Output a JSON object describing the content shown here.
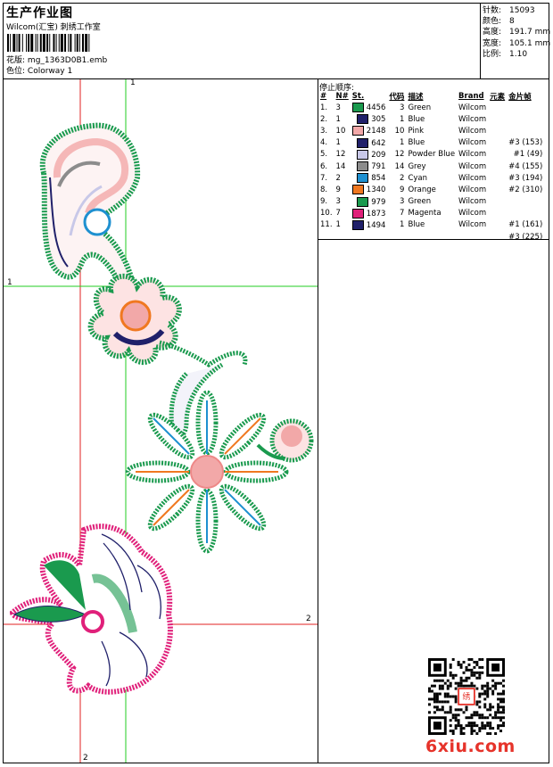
{
  "header": {
    "title": "生产作业图",
    "company": "Wilcom(汇宝) 刺绣工作室",
    "design_label": "花版:",
    "design_file": "mg_1363D0B1.emb",
    "colorway_label": "色位:",
    "colorway": "Colorway 1"
  },
  "stats": [
    {
      "label": "针数:",
      "value": "15093"
    },
    {
      "label": "颜色:",
      "value": "8"
    },
    {
      "label": "高度:",
      "value": "191.7 mm"
    },
    {
      "label": "宽度:",
      "value": "105.1 mm"
    },
    {
      "label": "比例:",
      "value": "1.10"
    }
  ],
  "sequence": {
    "title": "停止顺序:",
    "headers": [
      "#",
      "N#",
      "St.",
      "代码",
      "描述",
      "Brand",
      "元素",
      "金片帧"
    ],
    "rows": [
      {
        "n": "1.",
        "needle": "3",
        "color": "#1a9a4e",
        "st": "4456",
        "code": "3",
        "desc": "Green",
        "brand": "Wilcom",
        "elem": "",
        "seq": ""
      },
      {
        "n": "2.",
        "needle": "1",
        "color": "#20206a",
        "st": "305",
        "code": "1",
        "desc": "Blue",
        "brand": "Wilcom",
        "elem": "",
        "seq": ""
      },
      {
        "n": "3.",
        "needle": "10",
        "color": "#f2a8a8",
        "st": "2148",
        "code": "10",
        "desc": "Pink",
        "brand": "Wilcom",
        "elem": "",
        "seq": ""
      },
      {
        "n": "4.",
        "needle": "1",
        "color": "#20206a",
        "st": "642",
        "code": "1",
        "desc": "Blue",
        "brand": "Wilcom",
        "elem": "",
        "seq": "#3 (153)"
      },
      {
        "n": "5.",
        "needle": "12",
        "color": "#c8c8e8",
        "st": "209",
        "code": "12",
        "desc": "Powder Blue",
        "brand": "Wilcom",
        "elem": "",
        "seq": "#1 (49)"
      },
      {
        "n": "6.",
        "needle": "14",
        "color": "#8c8c8c",
        "st": "791",
        "code": "14",
        "desc": "Grey",
        "brand": "Wilcom",
        "elem": "",
        "seq": "#4 (155)"
      },
      {
        "n": "7.",
        "needle": "2",
        "color": "#1e90d0",
        "st": "854",
        "code": "2",
        "desc": "Cyan",
        "brand": "Wilcom",
        "elem": "",
        "seq": "#3 (194)"
      },
      {
        "n": "8.",
        "needle": "9",
        "color": "#f07820",
        "st": "1340",
        "code": "9",
        "desc": "Orange",
        "brand": "Wilcom",
        "elem": "",
        "seq": "#2 (310)"
      },
      {
        "n": "9.",
        "needle": "3",
        "color": "#1a9a4e",
        "st": "979",
        "code": "3",
        "desc": "Green",
        "brand": "Wilcom",
        "elem": "",
        "seq": ""
      },
      {
        "n": "10.",
        "needle": "7",
        "color": "#e0207a",
        "st": "1873",
        "code": "7",
        "desc": "Magenta",
        "brand": "Wilcom",
        "elem": "",
        "seq": ""
      },
      {
        "n": "11.",
        "needle": "1",
        "color": "#20206a",
        "st": "1494",
        "code": "1",
        "desc": "Blue",
        "brand": "Wilcom",
        "elem": "",
        "seq": "#1 (161)"
      }
    ],
    "extra_seq": "#3 (225)"
  },
  "guides": {
    "v1": "1",
    "h1": "1",
    "v2": "2",
    "h2": "2"
  },
  "watermark": "6xiu.com"
}
